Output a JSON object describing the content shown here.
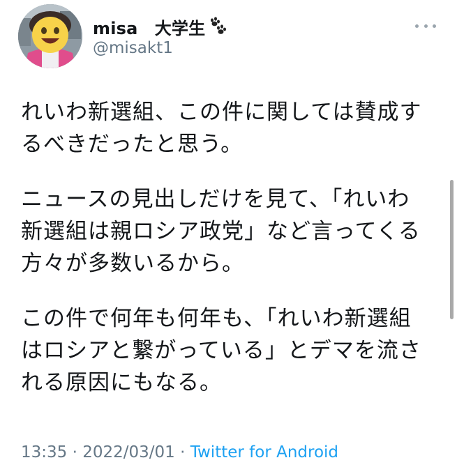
{
  "user": {
    "display_name": "misa　大学生",
    "handle": "@misakt1",
    "badge_icon": "paw-prints-icon",
    "avatar": "face-icon"
  },
  "tweet": {
    "paragraphs": [
      "れいわ新選組、この件に関しては賛成するべきだったと思う。",
      "ニュースの見出しだけを見て、「れいわ新選組は親ロシア政党」など言ってくる方々が多数いるから。",
      "この件で何年も何年も、「れいわ新選組はロシアと繋がっている」とデマを流される原因にもなる。"
    ],
    "time": "13:35",
    "separator": "·",
    "date": "2022/03/01",
    "source": "Twitter for Android"
  },
  "menu": {
    "icon": "more-dots-icon"
  },
  "colors": {
    "text": "#14171a",
    "secondary": "#657786",
    "link": "#1da1f2"
  }
}
